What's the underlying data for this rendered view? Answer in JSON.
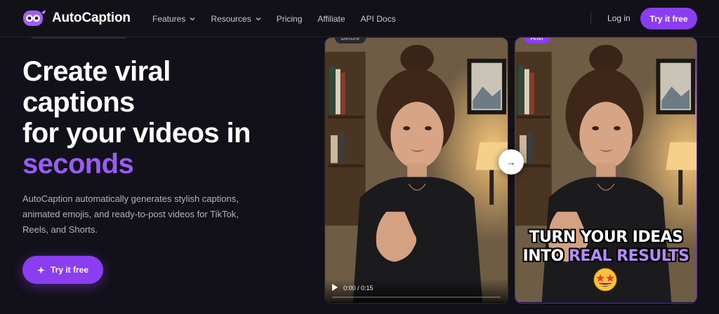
{
  "brand": {
    "name": "AutoCaption",
    "accent": "#8b3ef0",
    "highlight": "#9b5cf5"
  },
  "nav": {
    "links": [
      {
        "label": "Features",
        "has_dropdown": true
      },
      {
        "label": "Resources",
        "has_dropdown": true
      },
      {
        "label": "Pricing",
        "has_dropdown": false
      },
      {
        "label": "Affiliate",
        "has_dropdown": false
      },
      {
        "label": "API Docs",
        "has_dropdown": false
      }
    ],
    "login_label": "Log in",
    "cta_label": "Try it free"
  },
  "hero": {
    "headline_line1": "Create viral",
    "headline_line2": "captions",
    "headline_line3": "for your videos in",
    "headline_accent": "seconds",
    "subtext": "AutoCaption automatically generates stylish captions, animated emojis, and ready-to-post videos for TikTok, Reels, and Shorts.",
    "cta_label": "Try it free"
  },
  "video_before": {
    "badge": "Before",
    "time": "0:00 / 0:15"
  },
  "video_after": {
    "badge": "After",
    "caption_line1": "TURN YOUR IDEAS",
    "caption_line2_prefix": "INTO",
    "caption_line2_highlight": "REAL RESULTS",
    "emoji": "star-struck-emoji"
  },
  "compare_arrow": "→"
}
